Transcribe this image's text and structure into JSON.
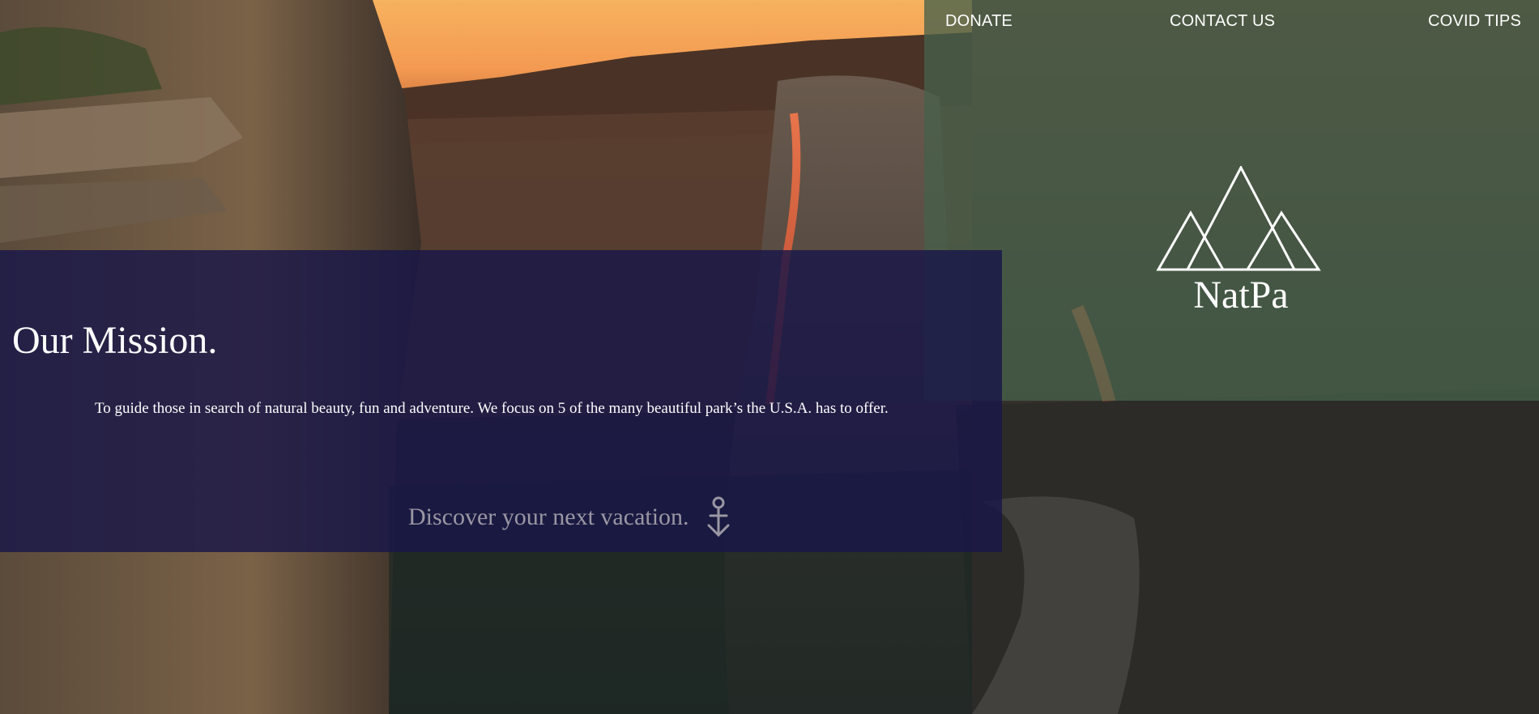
{
  "nav": {
    "donate": "DONATE",
    "contact": "CONTACT US",
    "covid": "COVID TIPS"
  },
  "brand": {
    "logo_icon": "mountains-icon",
    "name": "NatPa"
  },
  "mission": {
    "title": "Our Mission.",
    "text": "To guide those in search of natural beauty, fun and adventure. We focus on 5 of the many beautiful park’s the U.S.A. has to offer.",
    "cta": "Discover your next vacation.",
    "cta_icon": "anchor-arrow-down-icon"
  },
  "colors": {
    "brand_panel": "#46604a",
    "mission_panel": "#191648",
    "text": "#ffffff",
    "cta_text": "#9a97a4"
  }
}
